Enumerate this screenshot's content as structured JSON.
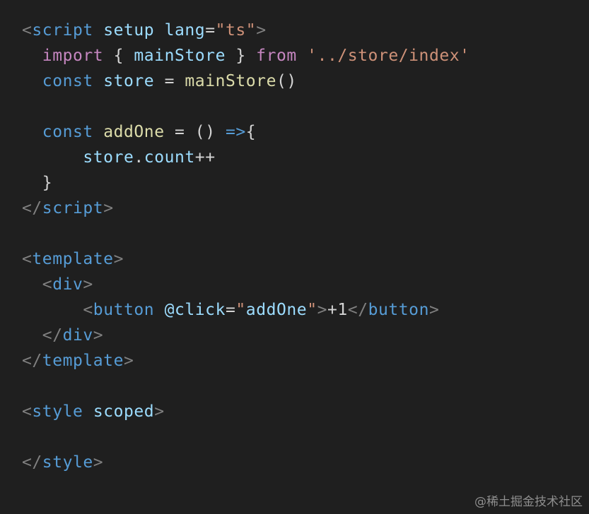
{
  "colors": {
    "background": "#1f1f1f",
    "tag_bracket": "#808080",
    "tag_name": "#569cd6",
    "attribute": "#9cdcfe",
    "operator": "#d4d4d4",
    "string": "#ce9178",
    "keyword_control": "#c586c0",
    "keyword_storage": "#569cd6",
    "variable": "#9cdcfe",
    "function": "#dcdcaa",
    "punctuation": "#d4d4d4",
    "plain_text": "#d4d4d4",
    "watermark": "#8e8e8e"
  },
  "code_lines": [
    [
      {
        "text": "<",
        "kind": "tag_bracket"
      },
      {
        "text": "script",
        "kind": "tag_name"
      },
      {
        "text": " ",
        "kind": "plain_text"
      },
      {
        "text": "setup",
        "kind": "attribute"
      },
      {
        "text": " ",
        "kind": "plain_text"
      },
      {
        "text": "lang",
        "kind": "attribute"
      },
      {
        "text": "=",
        "kind": "operator"
      },
      {
        "text": "\"ts\"",
        "kind": "string"
      },
      {
        "text": ">",
        "kind": "tag_bracket"
      }
    ],
    [
      {
        "text": "  ",
        "kind": "plain_text"
      },
      {
        "text": "import",
        "kind": "keyword_control"
      },
      {
        "text": " { ",
        "kind": "punctuation"
      },
      {
        "text": "mainStore",
        "kind": "variable"
      },
      {
        "text": " } ",
        "kind": "punctuation"
      },
      {
        "text": "from",
        "kind": "keyword_control"
      },
      {
        "text": " ",
        "kind": "plain_text"
      },
      {
        "text": "'../store/index'",
        "kind": "string"
      }
    ],
    [
      {
        "text": "  ",
        "kind": "plain_text"
      },
      {
        "text": "const",
        "kind": "keyword_storage"
      },
      {
        "text": " ",
        "kind": "plain_text"
      },
      {
        "text": "store",
        "kind": "variable"
      },
      {
        "text": " = ",
        "kind": "operator"
      },
      {
        "text": "mainStore",
        "kind": "function"
      },
      {
        "text": "()",
        "kind": "punctuation"
      }
    ],
    [],
    [
      {
        "text": "  ",
        "kind": "plain_text"
      },
      {
        "text": "const",
        "kind": "keyword_storage"
      },
      {
        "text": " ",
        "kind": "plain_text"
      },
      {
        "text": "addOne",
        "kind": "function"
      },
      {
        "text": " = ",
        "kind": "operator"
      },
      {
        "text": "() ",
        "kind": "punctuation"
      },
      {
        "text": "=>",
        "kind": "keyword_storage"
      },
      {
        "text": "{",
        "kind": "punctuation"
      }
    ],
    [
      {
        "text": "      ",
        "kind": "plain_text"
      },
      {
        "text": "store",
        "kind": "variable"
      },
      {
        "text": ".",
        "kind": "punctuation"
      },
      {
        "text": "count",
        "kind": "variable"
      },
      {
        "text": "++",
        "kind": "operator"
      }
    ],
    [
      {
        "text": "  }",
        "kind": "punctuation"
      }
    ],
    [
      {
        "text": "</",
        "kind": "tag_bracket"
      },
      {
        "text": "script",
        "kind": "tag_name"
      },
      {
        "text": ">",
        "kind": "tag_bracket"
      }
    ],
    [],
    [
      {
        "text": "<",
        "kind": "tag_bracket"
      },
      {
        "text": "template",
        "kind": "tag_name"
      },
      {
        "text": ">",
        "kind": "tag_bracket"
      }
    ],
    [
      {
        "text": "  ",
        "kind": "plain_text"
      },
      {
        "text": "<",
        "kind": "tag_bracket"
      },
      {
        "text": "div",
        "kind": "tag_name"
      },
      {
        "text": ">",
        "kind": "tag_bracket"
      }
    ],
    [
      {
        "text": "      ",
        "kind": "plain_text"
      },
      {
        "text": "<",
        "kind": "tag_bracket"
      },
      {
        "text": "button",
        "kind": "tag_name"
      },
      {
        "text": " ",
        "kind": "plain_text"
      },
      {
        "text": "@click",
        "kind": "attribute"
      },
      {
        "text": "=",
        "kind": "operator"
      },
      {
        "text": "\"",
        "kind": "string"
      },
      {
        "text": "addOne",
        "kind": "variable"
      },
      {
        "text": "\"",
        "kind": "string"
      },
      {
        "text": ">",
        "kind": "tag_bracket"
      },
      {
        "text": "+1",
        "kind": "plain_text"
      },
      {
        "text": "</",
        "kind": "tag_bracket"
      },
      {
        "text": "button",
        "kind": "tag_name"
      },
      {
        "text": ">",
        "kind": "tag_bracket"
      }
    ],
    [
      {
        "text": "  ",
        "kind": "plain_text"
      },
      {
        "text": "</",
        "kind": "tag_bracket"
      },
      {
        "text": "div",
        "kind": "tag_name"
      },
      {
        "text": ">",
        "kind": "tag_bracket"
      }
    ],
    [
      {
        "text": "</",
        "kind": "tag_bracket"
      },
      {
        "text": "template",
        "kind": "tag_name"
      },
      {
        "text": ">",
        "kind": "tag_bracket"
      }
    ],
    [],
    [
      {
        "text": "<",
        "kind": "tag_bracket"
      },
      {
        "text": "style",
        "kind": "tag_name"
      },
      {
        "text": " ",
        "kind": "plain_text"
      },
      {
        "text": "scoped",
        "kind": "attribute"
      },
      {
        "text": ">",
        "kind": "tag_bracket"
      }
    ],
    [],
    [
      {
        "text": "</",
        "kind": "tag_bracket"
      },
      {
        "text": "style",
        "kind": "tag_name"
      },
      {
        "text": ">",
        "kind": "tag_bracket"
      }
    ]
  ],
  "watermark": {
    "text": "@稀土掘金技术社区"
  }
}
